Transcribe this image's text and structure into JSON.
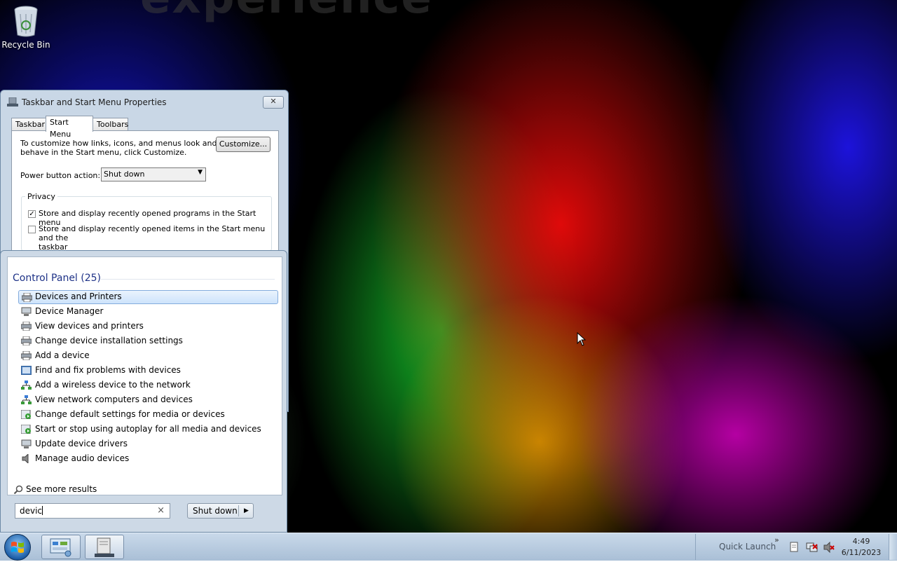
{
  "desktop": {
    "watermark": "experience",
    "icons": [
      {
        "label": "Recycle Bin",
        "icon": "recycle-bin-icon"
      }
    ]
  },
  "properties_dialog": {
    "title": "Taskbar and Start Menu Properties",
    "close_label": "✕",
    "tabs": [
      {
        "label": "Taskbar",
        "active": false
      },
      {
        "label": "Start Menu",
        "active": true
      },
      {
        "label": "Toolbars",
        "active": false
      }
    ],
    "description_line1": "To customize how links, icons, and menus look and",
    "description_line2": "behave in the Start menu, click Customize.",
    "customize_label": "Customize...",
    "power_button_label": "Power button action:",
    "power_button_value": "Shut down",
    "privacy_title": "Privacy",
    "privacy_options": [
      {
        "label": "Store and display recently opened programs in the Start menu",
        "checked": true
      },
      {
        "label_line1": "Store and display recently opened items in the Start menu and the",
        "label_line2": "taskbar",
        "checked": false
      }
    ]
  },
  "start_menu": {
    "group_title": "Control Panel (25)",
    "results": [
      {
        "label": "Devices and Printers",
        "icon": "printer-icon",
        "selected": true
      },
      {
        "label": "Device Manager",
        "icon": "device-manager-icon",
        "selected": false
      },
      {
        "label": "View devices and printers",
        "icon": "printer-icon",
        "selected": false
      },
      {
        "label": "Change device installation settings",
        "icon": "printer-icon",
        "selected": false
      },
      {
        "label": "Add a device",
        "icon": "printer-icon",
        "selected": false
      },
      {
        "label": "Find and fix problems with devices",
        "icon": "action-center-icon",
        "selected": false
      },
      {
        "label": "Add a wireless device to the network",
        "icon": "network-icon",
        "selected": false
      },
      {
        "label": "View network computers and devices",
        "icon": "network-icon",
        "selected": false
      },
      {
        "label": "Change default settings for media or devices",
        "icon": "autoplay-icon",
        "selected": false
      },
      {
        "label": "Start or stop using autoplay for all media and devices",
        "icon": "autoplay-icon",
        "selected": false
      },
      {
        "label": "Update device drivers",
        "icon": "device-manager-icon",
        "selected": false
      },
      {
        "label": "Manage audio devices",
        "icon": "speaker-icon",
        "selected": false
      }
    ],
    "see_more": "See more results",
    "search_value": "devic",
    "search_clear": "×",
    "shutdown_label": "Shut down"
  },
  "taskbar": {
    "quick_launch": "Quick Launch",
    "quick_launch_chevron": "»",
    "time": "4:49",
    "date": "6/11/2023"
  }
}
